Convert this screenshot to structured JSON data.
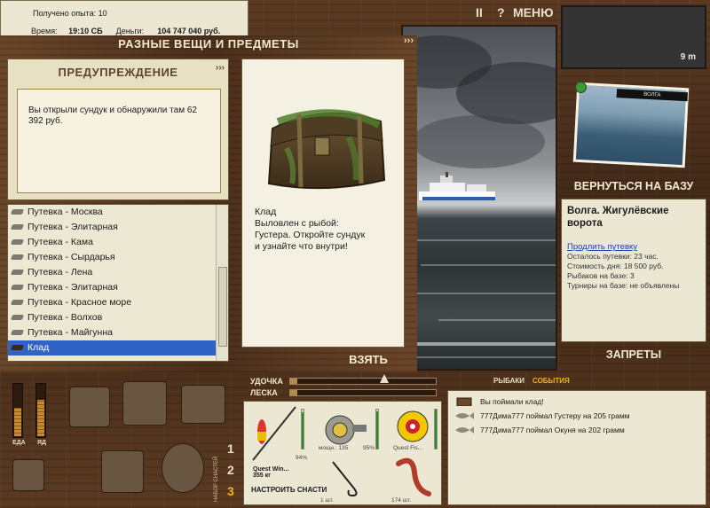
{
  "top_info": {
    "xp_label": "Получено опыта: 10",
    "time_label": "Время:",
    "time_value": "19:10 СБ",
    "money_label": "Деньги:",
    "money_value": "104 747 040 руб."
  },
  "top_controls": {
    "pause": "II",
    "help": "?",
    "menu": "МЕНЮ"
  },
  "items_window": {
    "title": "РАЗНЫЕ ВЕЩИ И ПРЕДМЕТЫ",
    "arrows": "›››",
    "warning_title": "ПРЕДУПРЕЖДЕНИЕ",
    "warning_arrows": "›››",
    "warning_text": "Вы открыли сундук и обнаружили там 62 392 руб.",
    "list": [
      "Путевка - Москва",
      "Путевка - Элитарная",
      "Путевка - Кама",
      "Путевка - Сырдарья",
      "Путевка - Лена",
      "Путевка - Элитарная",
      "Путевка - Красное море",
      "Путевка - Волхов",
      "Путевка - Майгунна",
      "Клад"
    ],
    "selected_index": 9,
    "detail_name": "Клад",
    "detail_line1": "Выловлен с рыбой:",
    "detail_line2": "Густера. Откройте сундук",
    "detail_line3": "и узнайте что внутри!",
    "take_button": "ВЗЯТЬ"
  },
  "right_panel": {
    "distance": "9 m",
    "photo_caption": "ВОЛГА",
    "back_to_base": "ВЕРНУТЬСЯ НА БАЗУ",
    "base_name": "Волга. Жигулёвские ворота",
    "extend_link": "Продлить путевку",
    "lines": [
      "Осталось путевки: 23 час.",
      "Стоимость дня: 18 500 руб.",
      "Рыбаков на базе: 3",
      "Турниры на базе: не объявлены"
    ],
    "bans": "ЗАПРЕТЫ"
  },
  "bottom": {
    "meter_food": "ЕДА",
    "meter_poison": "ЯД",
    "food_level": 0.55,
    "poison_level": 0.7,
    "slots": [
      "1",
      "2",
      "3"
    ],
    "slots_vertical": "НАБОР СНАСТЕЙ",
    "rod_label": "УДОЧКА",
    "line_label": "ЛЕСКА",
    "rod_tension": 0.05,
    "line_tension": 0.05,
    "rod_wear": "94%",
    "reel_power": "мощн.: 135",
    "reel_wear": "95%",
    "line_name": "Quest Fis...",
    "rod_name": "Quest Win...",
    "rod_weight": "355 кг",
    "setup_button": "НАСТРОИТЬ СНАСТИ",
    "hook_count": "1 шт.",
    "bait_count": "174 шт.",
    "tabs": {
      "fishers": "РЫБАКИ",
      "events": "СОБЫТИЯ"
    },
    "events": [
      "Вы поймали клад!",
      "777Дима777 поймал Густеру на 205 грамм",
      "777Дима777 поймал Окуня на 202 грамм"
    ]
  },
  "colors": {
    "selected_row": "#2f63c6",
    "wood": "#5b3a22",
    "parchment": "#ece7d2",
    "link": "#1f3fa8"
  }
}
